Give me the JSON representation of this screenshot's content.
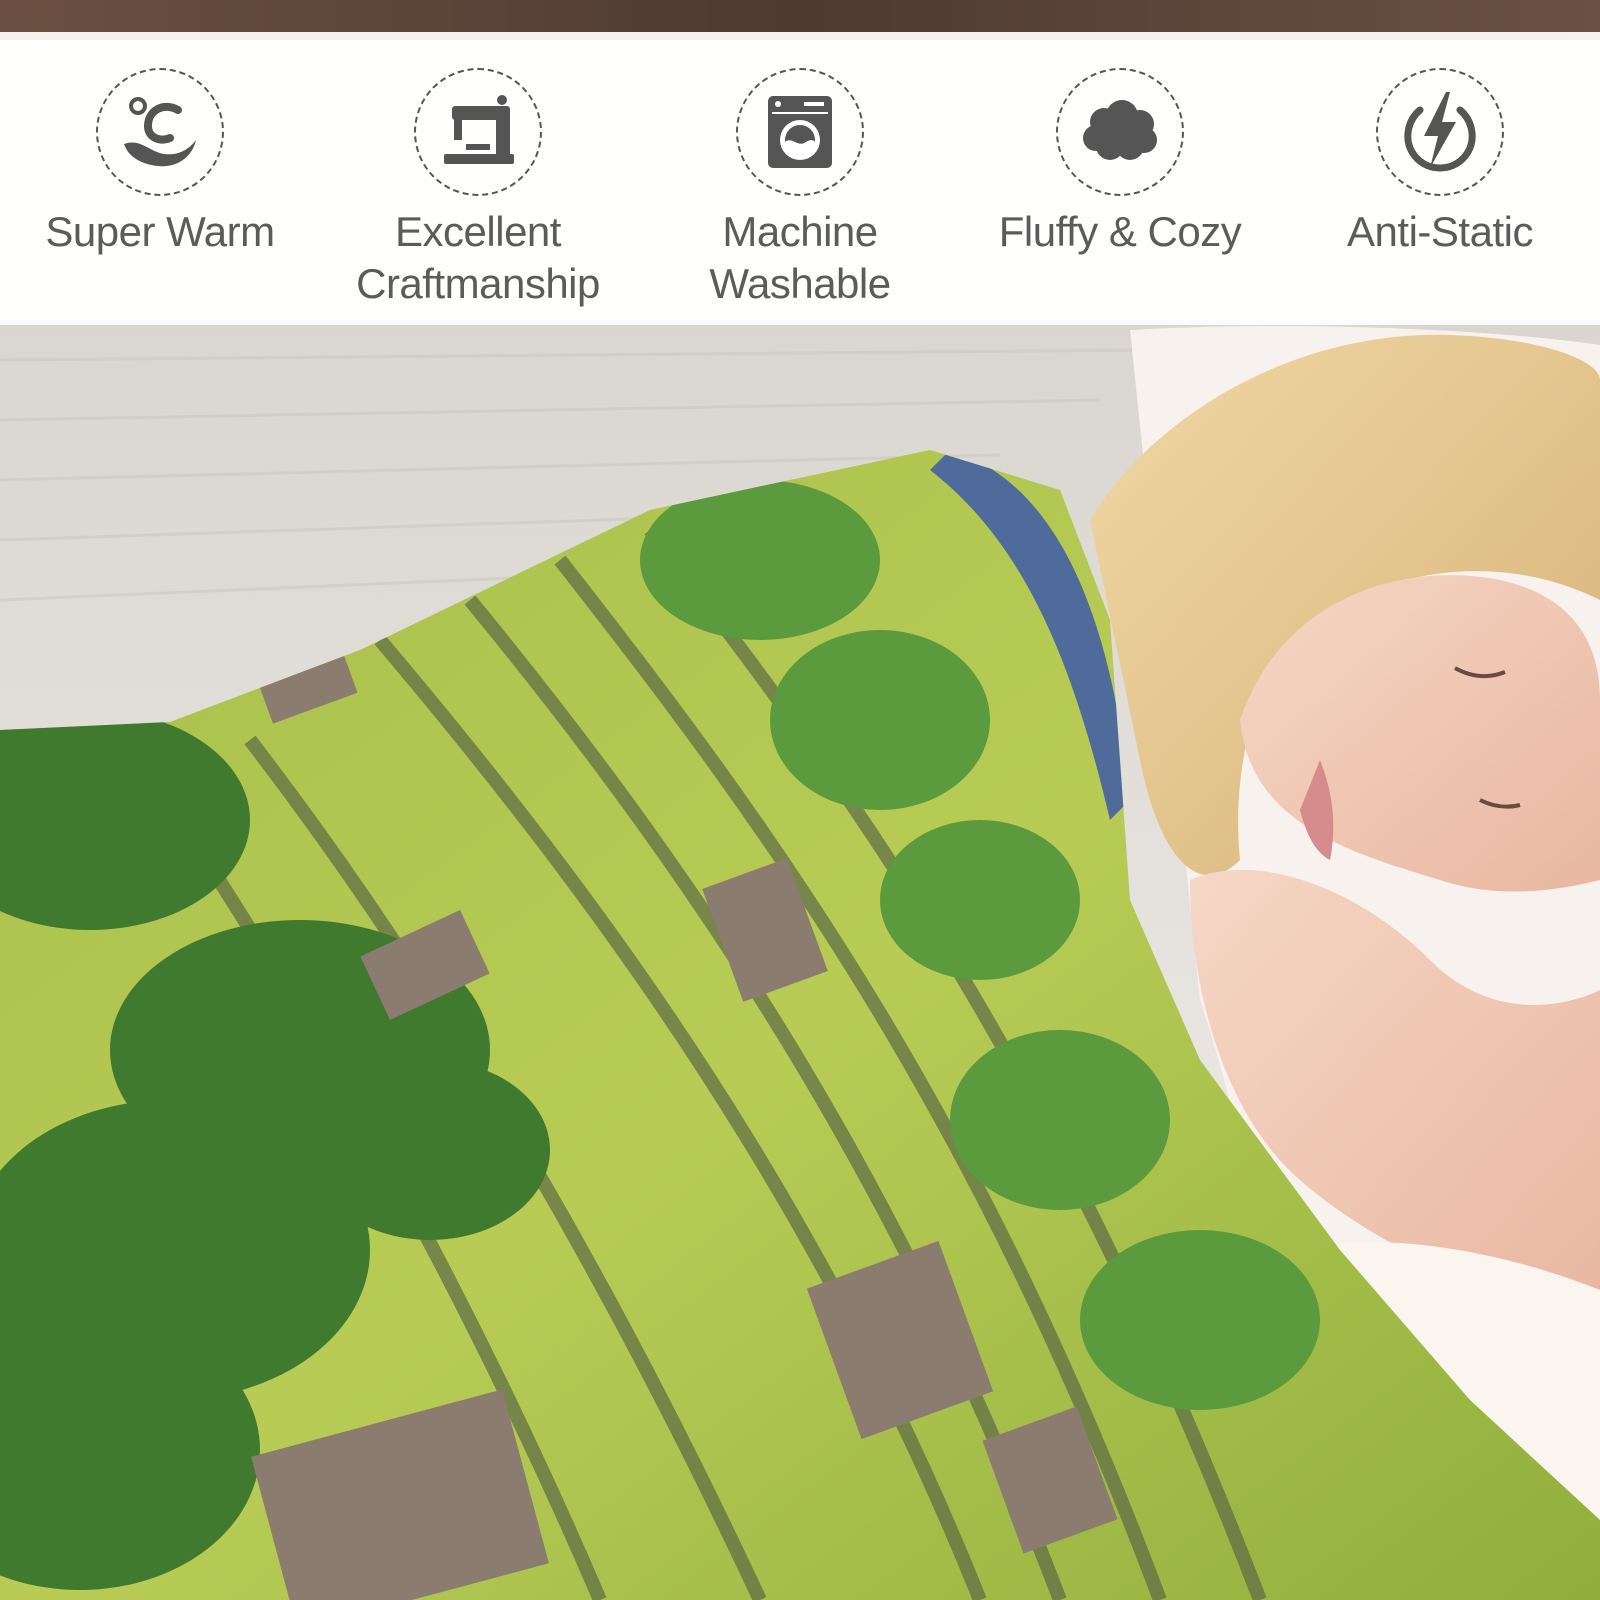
{
  "features": [
    {
      "label": "Super Warm",
      "icon": "warm-temperature-icon"
    },
    {
      "label": "Excellent\nCraftmanship",
      "icon": "sewing-machine-icon"
    },
    {
      "label": "Machine\nWashable",
      "icon": "washing-machine-icon"
    },
    {
      "label": "Fluffy & Cozy",
      "icon": "cloud-icon"
    },
    {
      "label": "Anti-Static",
      "icon": "lightning-icon"
    }
  ],
  "colors": {
    "icon": "#555555",
    "text": "#5b5b5b",
    "bar": "#ffffff"
  }
}
